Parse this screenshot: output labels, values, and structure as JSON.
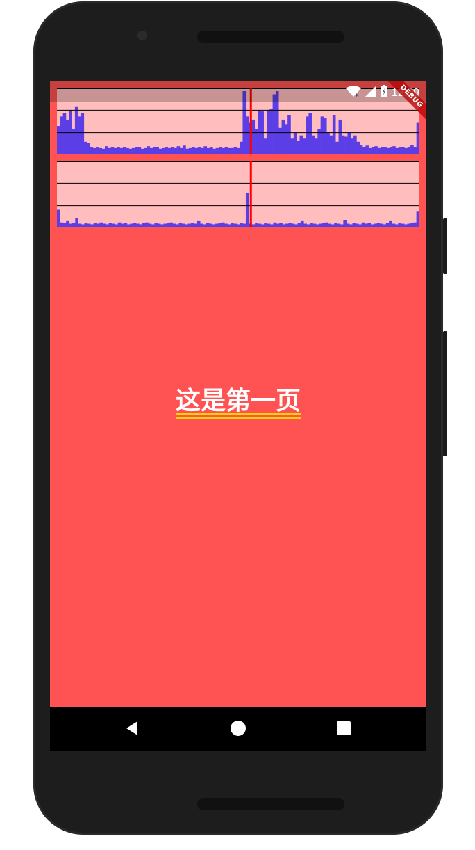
{
  "status_bar": {
    "time": "12:09",
    "icons": [
      "wifi-icon",
      "signal-icon",
      "battery-icon"
    ]
  },
  "debug_banner": {
    "label": "DEBUG"
  },
  "page": {
    "title": "这是第一页"
  },
  "navigation": {
    "items": [
      {
        "name": "back",
        "icon": "back-triangle-icon"
      },
      {
        "name": "home",
        "icon": "home-circle-icon"
      },
      {
        "name": "recents",
        "icon": "recents-square-icon"
      }
    ]
  },
  "colors": {
    "screen_background": "#ff5252",
    "overlay_background": "#ffbdbd",
    "bar_color": "#5b3ee6",
    "marker_color": "#ff0000",
    "underline_color": "#ffd400"
  },
  "chart_data": [
    {
      "type": "bar",
      "title": "",
      "values": [
        0.45,
        0.6,
        0.65,
        0.55,
        0.7,
        0.4,
        0.75,
        0.6,
        0.65,
        0.2,
        0.18,
        0.12,
        0.1,
        0.12,
        0.1,
        0.09,
        0.13,
        0.1,
        0.11,
        0.1,
        0.12,
        0.1,
        0.11,
        0.1,
        0.09,
        0.1,
        0.11,
        0.12,
        0.09,
        0.1,
        0.13,
        0.1,
        0.12,
        0.11,
        0.09,
        0.1,
        0.12,
        0.1,
        0.11,
        0.1,
        0.13,
        0.1,
        0.14,
        0.09,
        0.1,
        0.12,
        0.1,
        0.11,
        0.1,
        0.13,
        0.1,
        0.12,
        0.09,
        0.1,
        0.11,
        0.1,
        0.12,
        0.1,
        0.1,
        0.11,
        0.1,
        0.2,
        1.0,
        0.6,
        0.5,
        0.55,
        0.4,
        0.7,
        0.68,
        0.25,
        0.7,
        0.72,
        0.95,
        1.0,
        0.42,
        0.55,
        0.48,
        0.62,
        0.25,
        0.35,
        0.22,
        0.3,
        0.25,
        0.6,
        0.65,
        0.3,
        0.25,
        0.4,
        0.6,
        0.58,
        0.35,
        0.3,
        0.62,
        0.2,
        0.55,
        0.3,
        0.28,
        0.35,
        0.25,
        0.3,
        0.2,
        0.15,
        0.12,
        0.14,
        0.1,
        0.12,
        0.13,
        0.1,
        0.11,
        0.12,
        0.1,
        0.11,
        0.13,
        0.1,
        0.12,
        0.11,
        0.1,
        0.12,
        0.15,
        0.12,
        0.5
      ],
      "marker_fraction": 0.535,
      "reference_lines": [
        0.67,
        0.33
      ]
    },
    {
      "type": "bar",
      "title": "",
      "values": [
        0.28,
        0.08,
        0.07,
        0.1,
        0.06,
        0.07,
        0.15,
        0.06,
        0.05,
        0.07,
        0.06,
        0.05,
        0.07,
        0.06,
        0.08,
        0.06,
        0.05,
        0.07,
        0.06,
        0.05,
        0.08,
        0.06,
        0.07,
        0.05,
        0.06,
        0.07,
        0.06,
        0.05,
        0.07,
        0.08,
        0.06,
        0.05,
        0.07,
        0.06,
        0.05,
        0.06,
        0.07,
        0.08,
        0.06,
        0.05,
        0.07,
        0.06,
        0.05,
        0.06,
        0.07,
        0.06,
        0.1,
        0.06,
        0.05,
        0.07,
        0.06,
        0.05,
        0.06,
        0.07,
        0.08,
        0.06,
        0.05,
        0.07,
        0.06,
        0.05,
        0.07,
        0.06,
        0.55,
        0.06,
        0.05,
        0.07,
        0.06,
        0.05,
        0.07,
        0.06,
        0.05,
        0.08,
        0.06,
        0.07,
        0.05,
        0.06,
        0.07,
        0.06,
        0.05,
        0.07,
        0.1,
        0.06,
        0.05,
        0.07,
        0.06,
        0.05,
        0.06,
        0.07,
        0.08,
        0.06,
        0.05,
        0.07,
        0.06,
        0.05,
        0.12,
        0.06,
        0.05,
        0.07,
        0.06,
        0.05,
        0.08,
        0.06,
        0.07,
        0.05,
        0.06,
        0.07,
        0.06,
        0.05,
        0.07,
        0.1,
        0.06,
        0.05,
        0.07,
        0.06,
        0.05,
        0.06,
        0.07,
        0.08,
        0.25
      ],
      "marker_fraction": 0.535,
      "reference_lines": [
        0.67,
        0.33
      ]
    }
  ]
}
